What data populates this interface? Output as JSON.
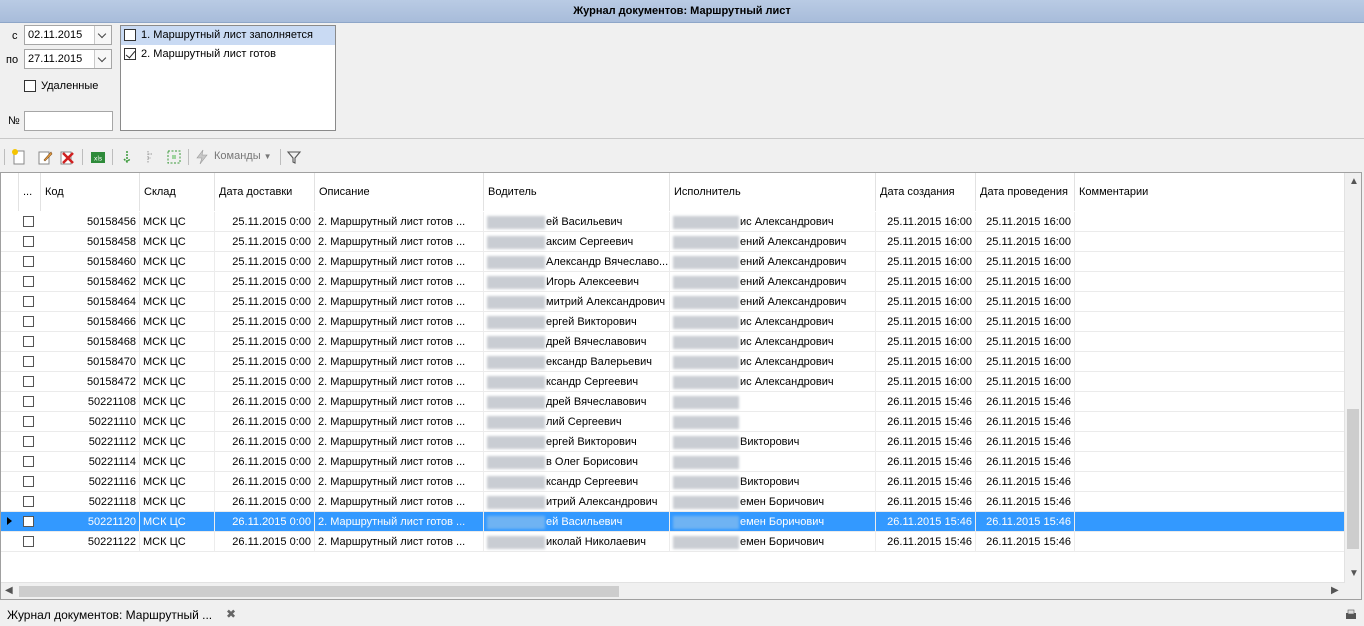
{
  "window": {
    "title": "Журнал документов: Маршрутный лист"
  },
  "filters": {
    "from_label": "с",
    "from_value": "02.11.2015",
    "to_label": "по",
    "to_value": "27.11.2015",
    "deleted_label": "Удаленные",
    "number_label": "№",
    "number_value": ""
  },
  "statuses": [
    {
      "label": "1. Маршрутный лист заполняется",
      "checked": false,
      "selected": true
    },
    {
      "label": "2. Маршрутный лист готов",
      "checked": true,
      "selected": false
    }
  ],
  "toolbar": {
    "commands_label": "Команды",
    "icons": [
      "new-document-icon",
      "edit-document-icon",
      "delete-icon",
      "excel-export-icon",
      "move-down-icon",
      "step-icon",
      "grid-select-icon",
      "lightning-icon",
      "filter-icon"
    ]
  },
  "grid": {
    "columns": [
      "...",
      "Код",
      "Склад",
      "Дата доставки",
      "Описание",
      "Водитель",
      "Исполнитель",
      "Дата создания",
      "Дата проведения",
      "Комментарии"
    ],
    "rows": [
      {
        "code": "50158456",
        "warehouse": "МСК ЦС",
        "delivery": "25.11.2015 0:00",
        "desc": "2. Маршрутный лист готов ...",
        "driver": "ей Васильевич",
        "executor": "ис Александрович",
        "created": "25.11.2015 16:00",
        "posted": "25.11.2015 16:00"
      },
      {
        "code": "50158458",
        "warehouse": "МСК ЦС",
        "delivery": "25.11.2015 0:00",
        "desc": "2. Маршрутный лист готов ...",
        "driver": "аксим Сергеевич",
        "executor": "ений Александрович",
        "created": "25.11.2015 16:00",
        "posted": "25.11.2015 16:00"
      },
      {
        "code": "50158460",
        "warehouse": "МСК ЦС",
        "delivery": "25.11.2015 0:00",
        "desc": "2. Маршрутный лист готов ...",
        "driver": "Александр Вячеславо...",
        "executor": "ений Александрович",
        "created": "25.11.2015 16:00",
        "posted": "25.11.2015 16:00"
      },
      {
        "code": "50158462",
        "warehouse": "МСК ЦС",
        "delivery": "25.11.2015 0:00",
        "desc": "2. Маршрутный лист готов ...",
        "driver": "Игорь Алексеевич",
        "executor": "ений Александрович",
        "created": "25.11.2015 16:00",
        "posted": "25.11.2015 16:00"
      },
      {
        "code": "50158464",
        "warehouse": "МСК ЦС",
        "delivery": "25.11.2015 0:00",
        "desc": "2. Маршрутный лист готов ...",
        "driver": "митрий Александрович",
        "executor": "ений Александрович",
        "created": "25.11.2015 16:00",
        "posted": "25.11.2015 16:00"
      },
      {
        "code": "50158466",
        "warehouse": "МСК ЦС",
        "delivery": "25.11.2015 0:00",
        "desc": "2. Маршрутный лист готов ...",
        "driver": "ергей Викторович",
        "executor": "ис Александрович",
        "created": "25.11.2015 16:00",
        "posted": "25.11.2015 16:00"
      },
      {
        "code": "50158468",
        "warehouse": "МСК ЦС",
        "delivery": "25.11.2015 0:00",
        "desc": "2. Маршрутный лист готов ...",
        "driver": "дрей Вячеславович",
        "executor": "ис Александрович",
        "created": "25.11.2015 16:00",
        "posted": "25.11.2015 16:00"
      },
      {
        "code": "50158470",
        "warehouse": "МСК ЦС",
        "delivery": "25.11.2015 0:00",
        "desc": "2. Маршрутный лист готов ...",
        "driver": "ександр Валерьевич",
        "executor": "ис Александрович",
        "created": "25.11.2015 16:00",
        "posted": "25.11.2015 16:00"
      },
      {
        "code": "50158472",
        "warehouse": "МСК ЦС",
        "delivery": "25.11.2015 0:00",
        "desc": "2. Маршрутный лист готов ...",
        "driver": "ксандр Сергеевич",
        "executor": "ис Александрович",
        "created": "25.11.2015 16:00",
        "posted": "25.11.2015 16:00"
      },
      {
        "code": "50221108",
        "warehouse": "МСК ЦС",
        "delivery": "26.11.2015 0:00",
        "desc": "2. Маршрутный лист готов ...",
        "driver": "дрей Вячеславович",
        "executor": "",
        "created": "26.11.2015 15:46",
        "posted": "26.11.2015 15:46"
      },
      {
        "code": "50221110",
        "warehouse": "МСК ЦС",
        "delivery": "26.11.2015 0:00",
        "desc": "2. Маршрутный лист готов ...",
        "driver": "лий Сергеевич",
        "executor": "",
        "created": "26.11.2015 15:46",
        "posted": "26.11.2015 15:46"
      },
      {
        "code": "50221112",
        "warehouse": "МСК ЦС",
        "delivery": "26.11.2015 0:00",
        "desc": "2. Маршрутный лист готов ...",
        "driver": "ергей Викторович",
        "executor": "Викторович",
        "created": "26.11.2015 15:46",
        "posted": "26.11.2015 15:46"
      },
      {
        "code": "50221114",
        "warehouse": "МСК ЦС",
        "delivery": "26.11.2015 0:00",
        "desc": "2. Маршрутный лист готов ...",
        "driver": "в Олег Борисович",
        "executor": "",
        "created": "26.11.2015 15:46",
        "posted": "26.11.2015 15:46"
      },
      {
        "code": "50221116",
        "warehouse": "МСК ЦС",
        "delivery": "26.11.2015 0:00",
        "desc": "2. Маршрутный лист готов ...",
        "driver": "ксандр Сергеевич",
        "executor": "Викторович",
        "created": "26.11.2015 15:46",
        "posted": "26.11.2015 15:46"
      },
      {
        "code": "50221118",
        "warehouse": "МСК ЦС",
        "delivery": "26.11.2015 0:00",
        "desc": "2. Маршрутный лист готов ...",
        "driver": "итрий Александрович",
        "executor": "емен Боричович",
        "created": "26.11.2015 15:46",
        "posted": "26.11.2015 15:46"
      },
      {
        "code": "50221120",
        "warehouse": "МСК ЦС",
        "delivery": "26.11.2015 0:00",
        "desc": "2. Маршрутный лист готов ...",
        "driver": "ей Васильевич",
        "executor": "емен Боричович",
        "created": "26.11.2015 15:46",
        "posted": "26.11.2015 15:46",
        "selected": true
      },
      {
        "code": "50221122",
        "warehouse": "МСК ЦС",
        "delivery": "26.11.2015 0:00",
        "desc": "2. Маршрутный лист готов ...",
        "driver": "иколай Николаевич",
        "executor": "емен Боричович",
        "created": "26.11.2015 15:46",
        "posted": "26.11.2015 15:46"
      }
    ]
  },
  "tabs": [
    {
      "label": "Журнал документов: Маршрутный ...",
      "close_icon": "close-icon"
    }
  ],
  "colors": {
    "selection": "#3399ff",
    "title_bar": "#b9cbe4",
    "status_selected": "#c9daf3"
  }
}
